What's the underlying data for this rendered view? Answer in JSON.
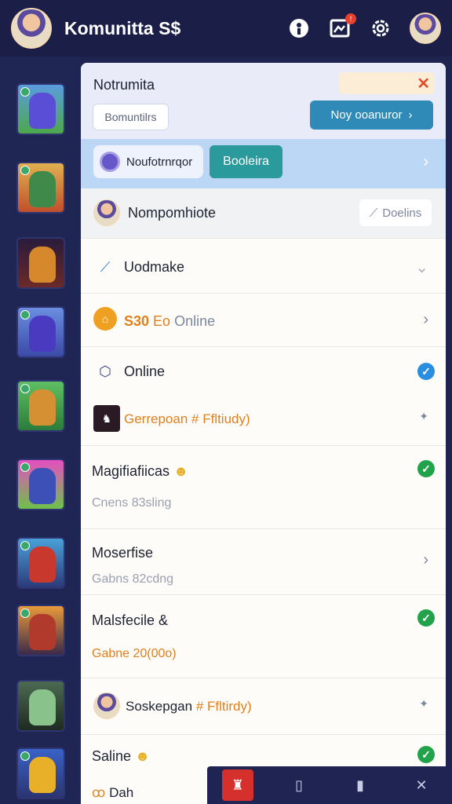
{
  "app": {
    "title": "Komunitta S$"
  },
  "header": {
    "title": "Notrumita",
    "input_text": "Bomuntilrs",
    "next_button": "Noy ooanuror",
    "close": "✕"
  },
  "filter": {
    "pill_label": "Noufotrnrqor",
    "teal_label": "Booleira"
  },
  "profile": {
    "name": "Nompomhiote",
    "action": "Doelins"
  },
  "rows": [
    {
      "label": "Uodmake"
    },
    {
      "label": "Online",
      "prefix": "S30",
      "prefix_rest": "Eo"
    },
    {
      "label": "Online"
    },
    {
      "label": "Gerrepoan",
      "suffix": "# Ffltiudy)"
    },
    {
      "label": "Magifiafiicas",
      "sub": "Cnens 83sling"
    },
    {
      "label": "Moserfise",
      "sub": "Gabns 82cdng"
    },
    {
      "label": "Malsfecile &",
      "sub": "Gabne 20(00o)"
    },
    {
      "label": "Soskepgan",
      "suffix": "# Ffltirdy)"
    },
    {
      "label": "Saline"
    },
    {
      "label": "Dah"
    }
  ],
  "bottom_nav": [
    "home",
    "book",
    "bookmark",
    "tools"
  ]
}
